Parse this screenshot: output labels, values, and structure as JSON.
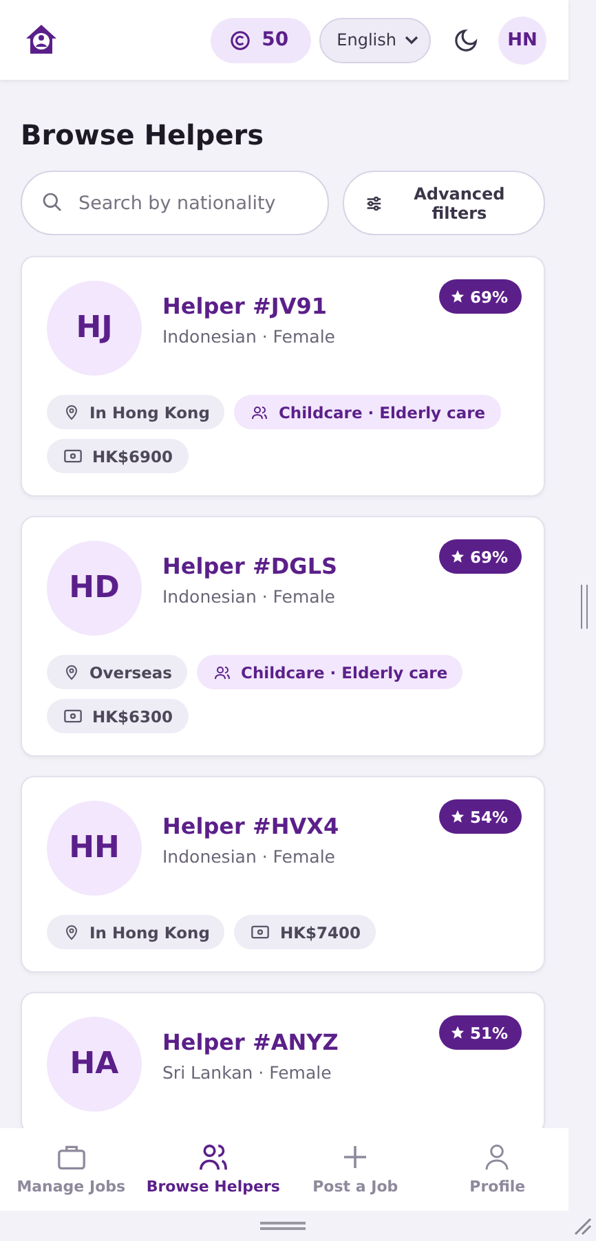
{
  "header": {
    "credits": "50",
    "language": "English",
    "avatar": "HN"
  },
  "title": "Browse Helpers",
  "search": {
    "placeholder": "Search by nationality"
  },
  "filters_button": "Advanced filters",
  "helpers": [
    {
      "initials": "HJ",
      "name": "Helper #JV91",
      "details": "Indonesian · Female",
      "rating": "69%",
      "tags": [
        {
          "kind": "location",
          "text": "In Hong Kong"
        },
        {
          "kind": "skills",
          "text": "Childcare · Elderly care"
        },
        {
          "kind": "salary",
          "text": "HK$6900"
        }
      ]
    },
    {
      "initials": "HD",
      "name": "Helper #DGLS",
      "details": "Indonesian · Female",
      "rating": "69%",
      "tags": [
        {
          "kind": "location",
          "text": "Overseas"
        },
        {
          "kind": "skills",
          "text": "Childcare · Elderly care"
        },
        {
          "kind": "salary",
          "text": "HK$6300"
        }
      ]
    },
    {
      "initials": "HH",
      "name": "Helper #HVX4",
      "details": "Indonesian · Female",
      "rating": "54%",
      "tags": [
        {
          "kind": "location",
          "text": "In Hong Kong"
        },
        {
          "kind": "salary",
          "text": "HK$7400"
        }
      ]
    },
    {
      "initials": "HA",
      "name": "Helper #ANYZ",
      "details": "Sri Lankan · Female",
      "rating": "51%"
    }
  ],
  "nav": [
    {
      "kind": "jobs",
      "label": "Manage Jobs",
      "selected": false
    },
    {
      "kind": "helpers",
      "label": "Browse Helpers",
      "selected": true
    },
    {
      "kind": "post",
      "label": "Post a Job",
      "selected": false
    },
    {
      "kind": "profile",
      "label": "Profile",
      "selected": false
    }
  ]
}
